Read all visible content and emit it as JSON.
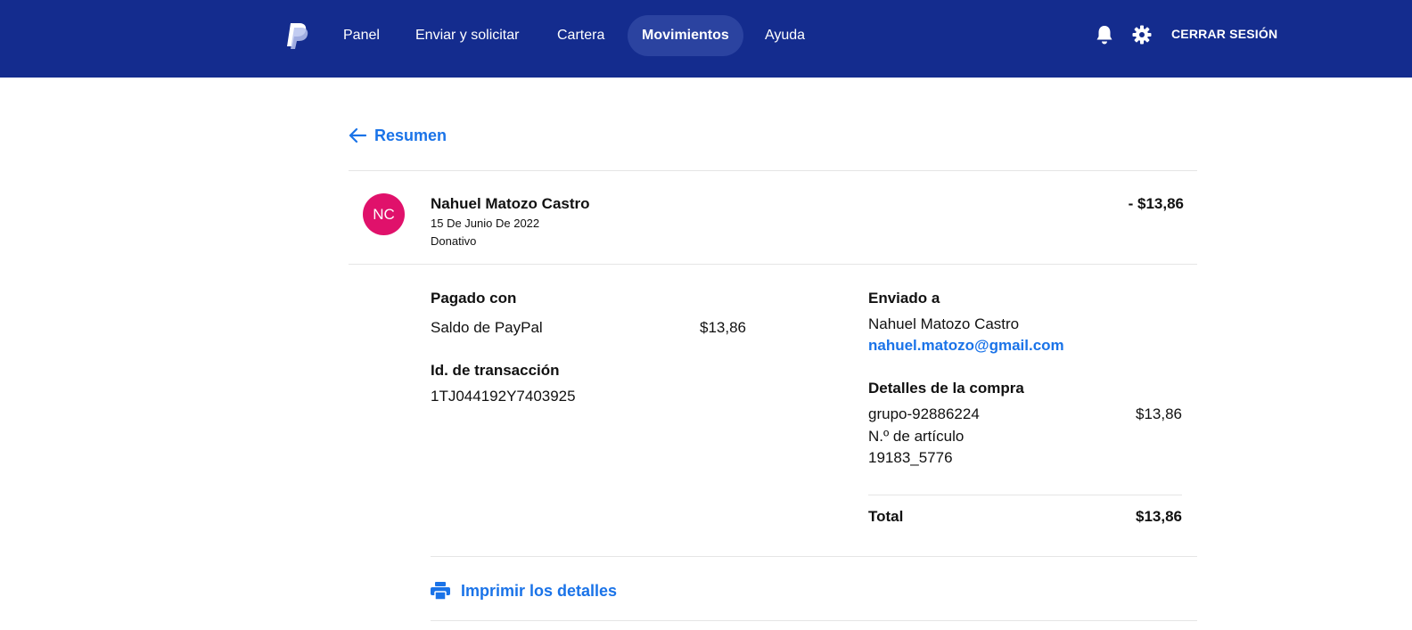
{
  "header": {
    "nav": [
      {
        "label": "Panel",
        "active": false
      },
      {
        "label": "Enviar y solicitar",
        "active": false
      },
      {
        "label": "Cartera",
        "active": false
      },
      {
        "label": "Movimientos",
        "active": true
      },
      {
        "label": "Ayuda",
        "active": false
      }
    ],
    "logout_label": "CERRAR SESIÓN",
    "brand_color": "#142c8e",
    "active_tab_color": "#2b43a0",
    "icons": [
      "paypal-logo",
      "bell-icon",
      "gear-icon"
    ]
  },
  "back": {
    "label": "Resumen",
    "icon": "arrow-left-icon"
  },
  "transaction": {
    "initials": "NC",
    "avatar_color": "#e0116b",
    "name": "Nahuel Matozo Castro",
    "date": "15 De Junio De 2022",
    "type": "Donativo",
    "amount": "- $13,86"
  },
  "details": {
    "paid_with_label": "Pagado con",
    "source": "Saldo de PayPal",
    "source_amount": "$13,86",
    "txn_id_label": "Id. de transacción",
    "txn_id": "1TJ044192Y7403925",
    "sent_to_label": "Enviado a",
    "recipient_name": "Nahuel Matozo Castro",
    "recipient_email": "nahuel.matozo@gmail.com",
    "purchase_label": "Detalles de la compra",
    "item_name": "grupo-92886224",
    "item_amount": "$13,86",
    "item_number_label": "N.º de artículo",
    "item_number": "19183_5776",
    "total_label": "Total",
    "total_amount": "$13,86"
  },
  "print": {
    "label": "Imprimir los detalles",
    "icon": "printer-icon"
  },
  "link_color": "#1a73e8"
}
